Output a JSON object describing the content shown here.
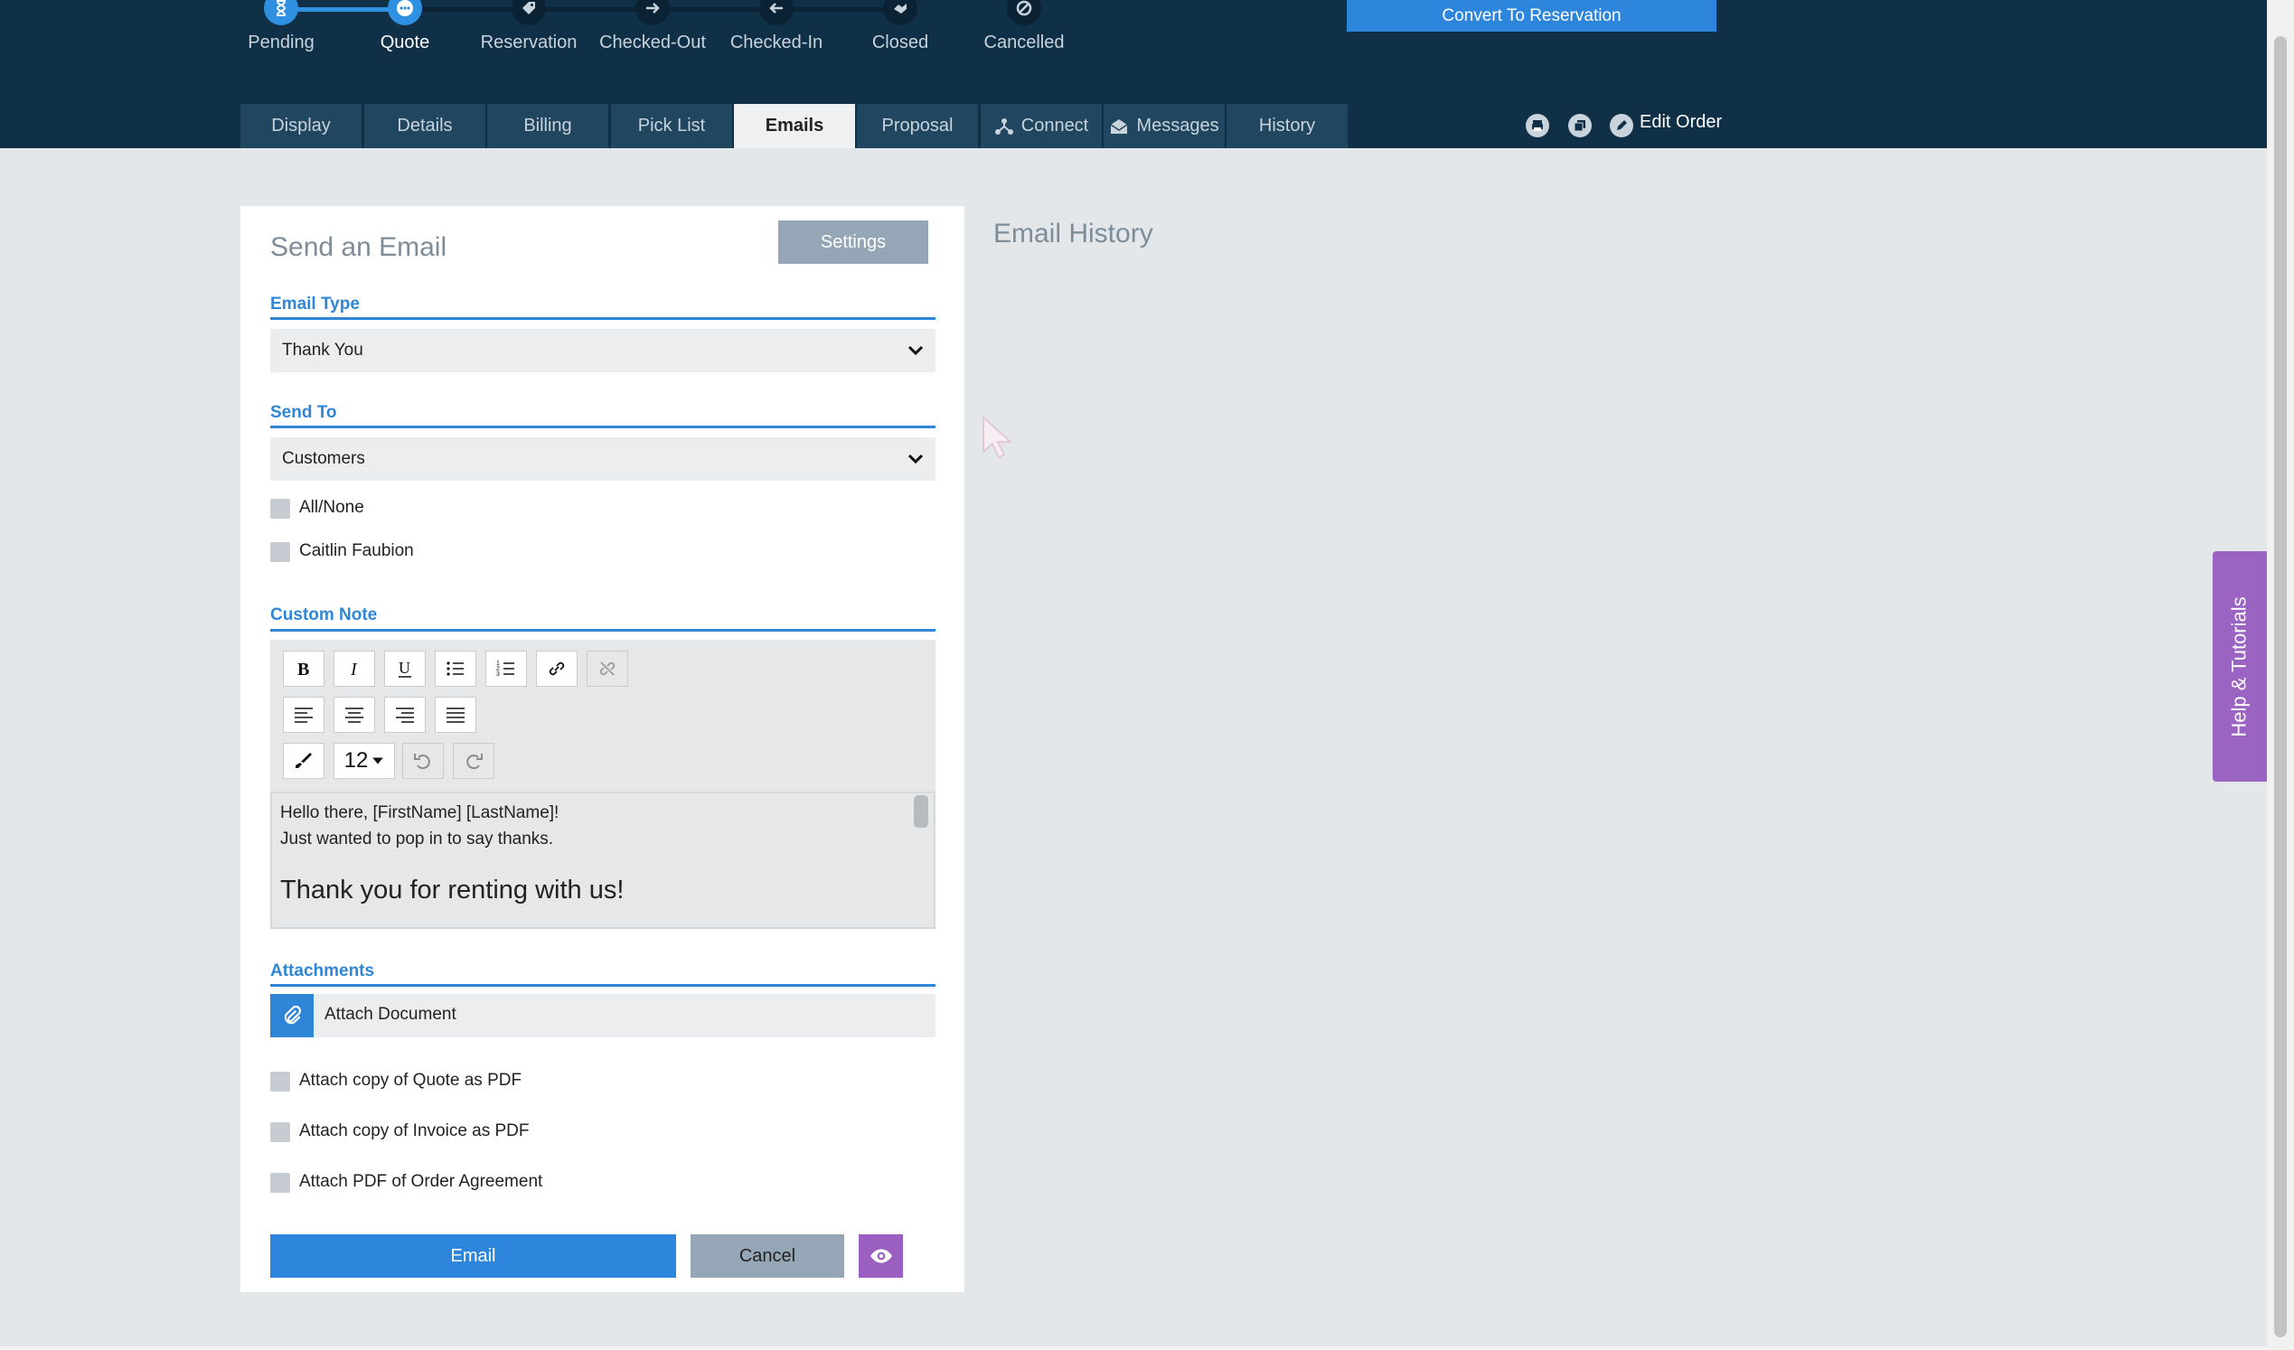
{
  "status_steps": [
    {
      "label": "Pending",
      "icon": "hourglass-icon",
      "state": "done"
    },
    {
      "label": "Quote",
      "icon": "ellipsis-icon",
      "state": "current"
    },
    {
      "label": "Reservation",
      "icon": "tag-icon",
      "state": "todo"
    },
    {
      "label": "Checked-Out",
      "icon": "arrow-right-icon",
      "state": "todo"
    },
    {
      "label": "Checked-In",
      "icon": "arrow-left-icon",
      "state": "todo"
    },
    {
      "label": "Closed",
      "icon": "handshake-icon",
      "state": "todo"
    },
    {
      "label": "Cancelled",
      "icon": "ban-icon",
      "state": "todo"
    }
  ],
  "header": {
    "convert_button": "Convert To Reservation",
    "edit_order": "Edit Order"
  },
  "tabs": [
    {
      "label": "Display"
    },
    {
      "label": "Details"
    },
    {
      "label": "Billing"
    },
    {
      "label": "Pick List"
    },
    {
      "label": "Emails"
    },
    {
      "label": "Proposal"
    },
    {
      "label": "Connect"
    },
    {
      "label": "Messages"
    },
    {
      "label": "History"
    }
  ],
  "active_tab": "Emails",
  "send_email": {
    "title": "Send an Email",
    "settings_button": "Settings",
    "email_type_label": "Email Type",
    "email_type_value": "Thank You",
    "send_to_label": "Send To",
    "send_to_value": "Customers",
    "recipients": [
      "All/None",
      "Caitlin Faubion"
    ],
    "custom_note_label": "Custom Note",
    "font_size": "12",
    "note_lines": [
      "Hello there, [FirstName] [LastName]!",
      "Just wanted to pop in to say thanks."
    ],
    "note_heading": "Thank you for renting with us!",
    "attachments_label": "Attachments",
    "attach_document": "Attach Document",
    "attach_options": [
      "Attach copy of Quote as PDF",
      "Attach copy of Invoice as PDF",
      "Attach PDF of Order Agreement"
    ],
    "email_button": "Email",
    "cancel_button": "Cancel"
  },
  "email_history": {
    "title": "Email History"
  },
  "help_tab": "Help & Tutorials",
  "colors": {
    "header_bg": "#0f3047",
    "accent": "#2d86dc",
    "purple": "#9b64c2",
    "muted_button": "#95a7b6"
  }
}
